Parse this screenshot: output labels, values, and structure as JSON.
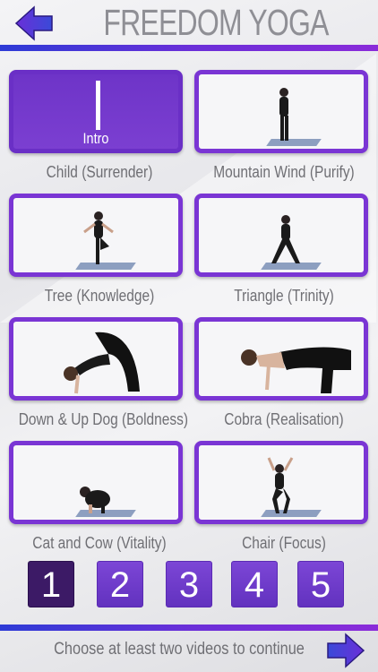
{
  "header": {
    "title": "FREEDOM YOGA"
  },
  "videos": [
    {
      "label": "Child (Surrender)",
      "thumb": "Intro",
      "selected": true
    },
    {
      "label": "Mountain Wind (Purify)"
    },
    {
      "label": "Tree (Knowledge)"
    },
    {
      "label": "Triangle (Trinity)"
    },
    {
      "label": "Down & Up Dog (Boldness)"
    },
    {
      "label": "Cobra (Realisation)"
    },
    {
      "label": "Cat and Cow (Vitality)"
    },
    {
      "label": "Chair (Focus)"
    }
  ],
  "pages": [
    "1",
    "2",
    "3",
    "4",
    "5"
  ],
  "footer": {
    "instruction": "Choose at least two videos to continue"
  },
  "colors": {
    "accent": "#7a35d4",
    "active_page": "#3c1a66",
    "arrow": "#5a3ad8"
  }
}
